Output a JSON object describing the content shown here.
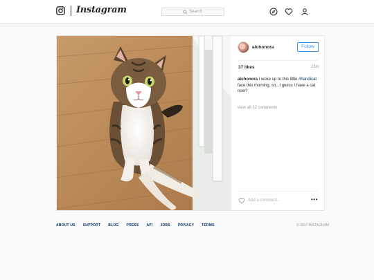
{
  "nav": {
    "wordmark": "Instagram",
    "search_placeholder": "Search",
    "icons": [
      "instagram-logo-icon",
      "search-icon",
      "compass-icon",
      "heart-icon",
      "user-icon"
    ]
  },
  "post": {
    "username": "alohonora",
    "follow_label": "Follow",
    "likes": "37 likes",
    "time": "23m",
    "caption": {
      "user": "alohonora",
      "before": " I woke up to this little ",
      "hashtag": "#handicat",
      "after": " face this morning, so...I guess I have a cat now?"
    },
    "view_all": "view all 12 comments",
    "add_comment": "Add a comment...",
    "more": "•••"
  },
  "footer": {
    "links": [
      "ABOUT US",
      "SUPPORT",
      "BLOG",
      "PRESS",
      "API",
      "JOBS",
      "PRIVACY",
      "TERMS"
    ],
    "copyright": "© 2017 INSTAGRAM"
  },
  "colors": {
    "accent": "#3897f0",
    "link": "#003569",
    "border": "#e6e6e6"
  }
}
